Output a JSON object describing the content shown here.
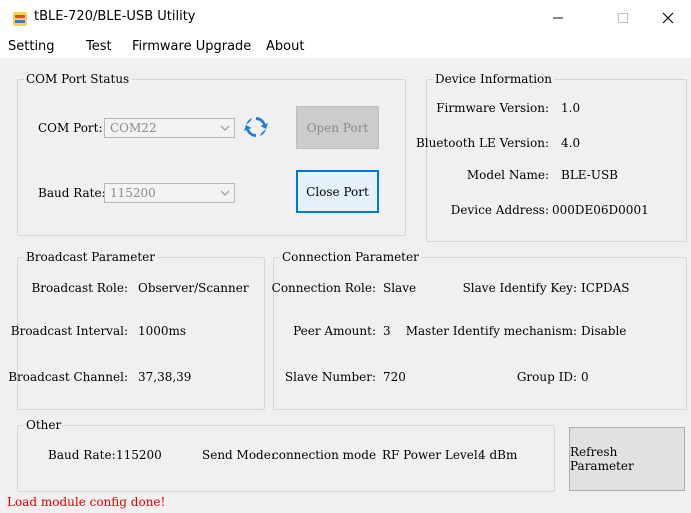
{
  "window": {
    "title": "tBLE-720/BLE-USB Utility"
  },
  "menu": [
    "Setting",
    "Test",
    "Firmware Upgrade",
    "About"
  ],
  "com_port_status": {
    "legend": "COM Port Status",
    "com_port_label": "COM Port:",
    "com_port_value": "COM22",
    "baud_rate_label": "Baud Rate:",
    "baud_rate_value": "115200",
    "open_port": "Open Port",
    "close_port": "Close Port"
  },
  "device_information": {
    "legend": "Device Information",
    "firmware_label": "Firmware Version:",
    "firmware_value": "1.0",
    "ble_label": "Bluetooth LE Version:",
    "ble_value": "4.0",
    "model_label": "Model Name:",
    "model_value": "BLE-USB",
    "address_label": "Device Address:",
    "address_value": "000DE06D0001"
  },
  "broadcast_parameter": {
    "legend": "Broadcast Parameter",
    "role_label": "Broadcast Role:",
    "role_value": "Observer/Scanner",
    "interval_label": "Broadcast Interval:",
    "interval_value": "1000ms",
    "channel_label": "Broadcast Channel:",
    "channel_value": "37,38,39"
  },
  "connection_parameter": {
    "legend": "Connection Parameter",
    "role_label": "Connection Role:",
    "role_value": "Slave",
    "peer_label": "Peer Amount:",
    "peer_value": "3",
    "slave_num_label": "Slave Number:",
    "slave_num_value": "720",
    "key_label": "Slave Identify Key:",
    "key_value": "ICPDAS",
    "mechanism_label": "Master Identify mechanism:",
    "mechanism_value": "Disable",
    "group_label": "Group ID:",
    "group_value": "0"
  },
  "other": {
    "legend": "Other",
    "baud_label": "Baud Rate:",
    "baud_value": "115200",
    "send_mode_label": "Send Mode:",
    "send_mode_value": "connection mode",
    "rf_label": "RF Power Level:",
    "rf_value": "4 dBm"
  },
  "refresh_button": "Refresh Parameter",
  "status_message": "Load module config done!",
  "colors": {
    "focus_border": "#0078d7",
    "status_text": "#e00000",
    "refresh_icon": "#1e7fd6"
  }
}
